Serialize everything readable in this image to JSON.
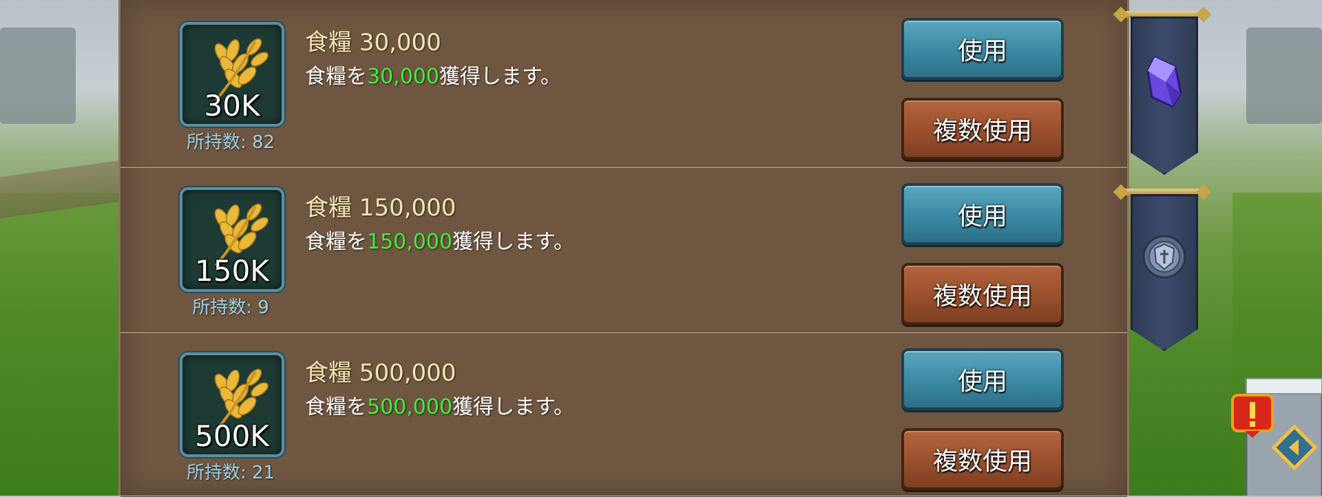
{
  "items": [
    {
      "title": "食糧 30,000",
      "desc_prefix": "食糧を",
      "desc_amount": "30,000",
      "desc_suffix": "獲得します。",
      "icon_label": "30K",
      "owned": "所持数: 82",
      "use_label": "使用",
      "multi_label": "複数使用"
    },
    {
      "title": "食糧 150,000",
      "desc_prefix": "食糧を",
      "desc_amount": "150,000",
      "desc_suffix": "獲得します。",
      "icon_label": "150K",
      "owned": "所持数: 9",
      "use_label": "使用",
      "multi_label": "複数使用"
    },
    {
      "title": "食糧 500,000",
      "desc_prefix": "食糧を",
      "desc_amount": "500,000",
      "desc_suffix": "獲得します。",
      "icon_label": "500K",
      "owned": "所持数: 21",
      "use_label": "使用",
      "multi_label": "複数使用"
    }
  ],
  "side_tabs": [
    {
      "icon": "gem-icon"
    },
    {
      "icon": "shield-icon"
    }
  ],
  "colors": {
    "panel": "#6e5641",
    "highlight": "#3ef03a",
    "title": "#f3e6b3",
    "owned": "#9ed0e6",
    "use_button": "#3b88a2",
    "multi_button": "#9a4f2c"
  }
}
